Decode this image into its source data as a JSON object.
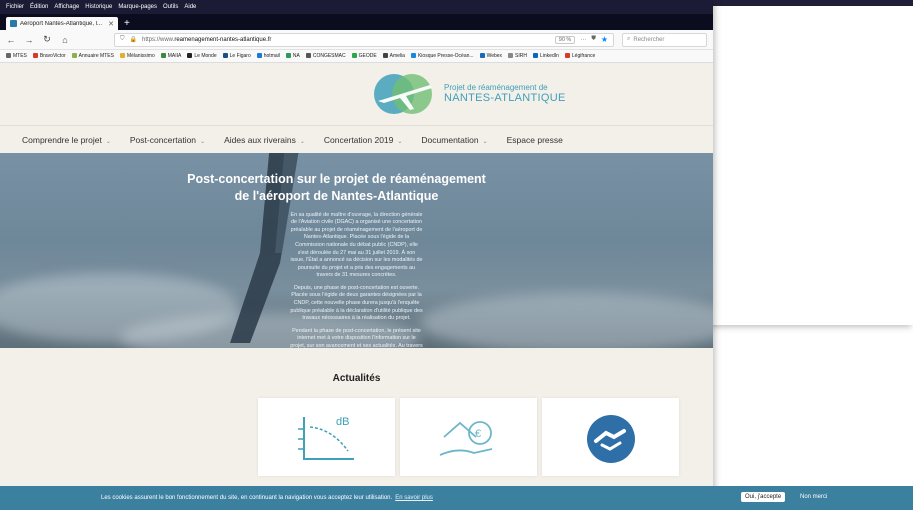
{
  "menubar": [
    "Fichier",
    "Édition",
    "Affichage",
    "Historique",
    "Marque-pages",
    "Outils",
    "Aide"
  ],
  "tab": {
    "title": "Aéroport Nantes-Atlantique, l...",
    "close": "✕",
    "new": "+"
  },
  "nav": {
    "url_prefix": "https://www.",
    "url_domain": "reamenagement-nantes-atlantique.fr",
    "zoom": "90 %",
    "search_placeholder": "Rechercher"
  },
  "bookmarks": [
    {
      "label": "MTES",
      "color": "#666666"
    },
    {
      "label": "BravoVictor",
      "color": "#d83a2a"
    },
    {
      "label": "Annuaire MTES",
      "color": "#8cb04a"
    },
    {
      "label": "Mélanissimo",
      "color": "#e0b030"
    },
    {
      "label": "MAIIA",
      "color": "#3b8a3b"
    },
    {
      "label": "Le Monde",
      "color": "#222222"
    },
    {
      "label": "Le Figaro",
      "color": "#1a4f8a"
    },
    {
      "label": "hotmail",
      "color": "#1a7ad8"
    },
    {
      "label": "NA",
      "color": "#2a9a5a"
    },
    {
      "label": "CONGESMAC",
      "color": "#555555"
    },
    {
      "label": "GEODE",
      "color": "#2aa84a"
    },
    {
      "label": "Amelia",
      "color": "#444444"
    },
    {
      "label": "Kiosque Presse-Océan...",
      "color": "#1a8ad8"
    },
    {
      "label": "Webex",
      "color": "#1a6ab8"
    },
    {
      "label": "SIRH",
      "color": "#888888"
    },
    {
      "label": "LinkedIn",
      "color": "#0a66c2"
    },
    {
      "label": "Légifrance",
      "color": "#d83a2a"
    }
  ],
  "logo": {
    "line1": "Projet de réaménagement de",
    "line2": "NANTES-ATLANTIQUE"
  },
  "site_nav": [
    {
      "label": "Comprendre le projet",
      "caret": true
    },
    {
      "label": "Post-concertation",
      "caret": true
    },
    {
      "label": "Aides aux riverains",
      "caret": true
    },
    {
      "label": "Concertation 2019",
      "caret": true
    },
    {
      "label": "Documentation",
      "caret": true
    },
    {
      "label": "Espace presse",
      "caret": false
    }
  ],
  "hero": {
    "title_line1": "Post-concertation sur le projet de réaménagement",
    "title_line2": "de l'aéroport de Nantes-Atlantique",
    "paragraphs": [
      "En sa qualité de maître d'ouvrage, la direction générale de l'Aviation civile (DGAC) a organisé une concertation préalable au projet de réaménagement de l'aéroport de Nantes-Atlantique. Placée sous l'égide de la Commission nationale du débat public (CNDP), elle s'est déroulée du 27 mai au 31 juillet 2019. À son issue, l'État a annoncé sa décision sur les modalités de poursuite du projet et a pris des engagements au travers de 31 mesures concrètes.",
      "Depuis, une phase de post-concertation est ouverte. Placée sous l'égide de deux garantes désignées par la CNDP, cette nouvelle phase durera jusqu'à l'enquête publique préalable à la déclaration d'utilité publique des travaux nécessaires à la réalisation du projet.",
      "Pendant la phase de post-concertation, le présent site internet met à votre disposition l'information sur le projet, sur son avancement et ses actualités. Au travers de ce site, vous pouvez aussi poser des questions écrites au maître d'ouvrage du projet."
    ]
  },
  "news": {
    "title": "Actualités",
    "card1_label": "dB"
  },
  "cookie": {
    "text": "Les cookies assurent le bon fonctionnement du site, en continuant la navigation vous acceptez leur utilisation.",
    "link": "En savoir plus",
    "accept": "Oui, j'accepte",
    "decline": "Non merci"
  },
  "colors": {
    "accent": "#3c80a0",
    "logo_teal": "#3fa0b8",
    "logo_green": "#6fbf73",
    "icon_blue": "#2f6fa8"
  }
}
